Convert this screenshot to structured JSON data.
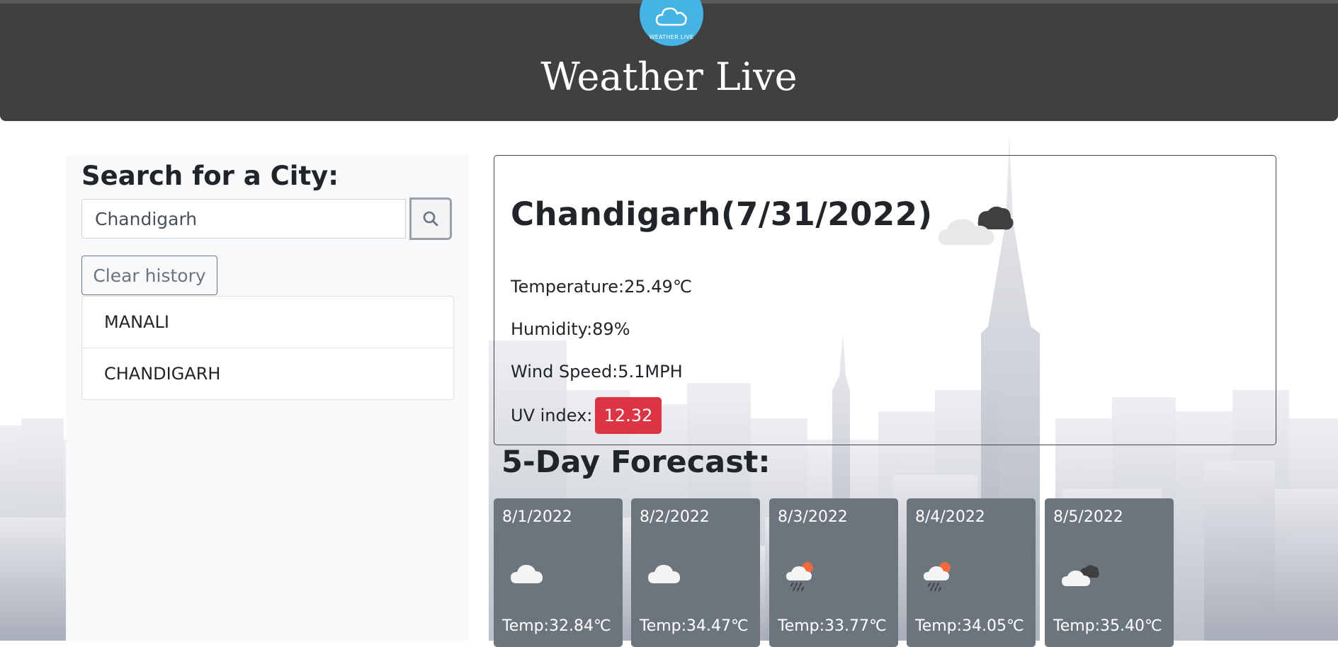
{
  "header": {
    "logo_text": "WEATHER LIVE",
    "title": "Weather Live"
  },
  "sidebar": {
    "heading": "Search for a City:",
    "search_value": "Chandigarh",
    "clear_label": "Clear history",
    "history": [
      "MANALI",
      "CHANDIGARH"
    ]
  },
  "current": {
    "title": "Chandigarh(7/31/2022)",
    "icon": "cloudy-night-icon",
    "temperature": "Temperature:25.49℃",
    "humidity": "Humidity:89%",
    "wind": "Wind Speed:5.1MPH",
    "uv_label": "UV index:",
    "uv_value": "12.32",
    "uv_color": "#dc3545"
  },
  "forecast": {
    "heading": "5-Day Forecast:",
    "days": [
      {
        "date": "8/1/2022",
        "icon": "cloud-icon",
        "temp": "Temp:32.84℃"
      },
      {
        "date": "8/2/2022",
        "icon": "cloud-icon",
        "temp": "Temp:34.47℃"
      },
      {
        "date": "8/3/2022",
        "icon": "rain-sun-icon",
        "temp": "Temp:33.77℃"
      },
      {
        "date": "8/4/2022",
        "icon": "rain-sun-icon",
        "temp": "Temp:34.05℃"
      },
      {
        "date": "8/5/2022",
        "icon": "cloudy-night-icon",
        "temp": "Temp:35.40℃"
      }
    ]
  },
  "colors": {
    "header_bg": "#404040",
    "logo_bg": "#45b4e3",
    "card_bg": "#6c757d"
  }
}
